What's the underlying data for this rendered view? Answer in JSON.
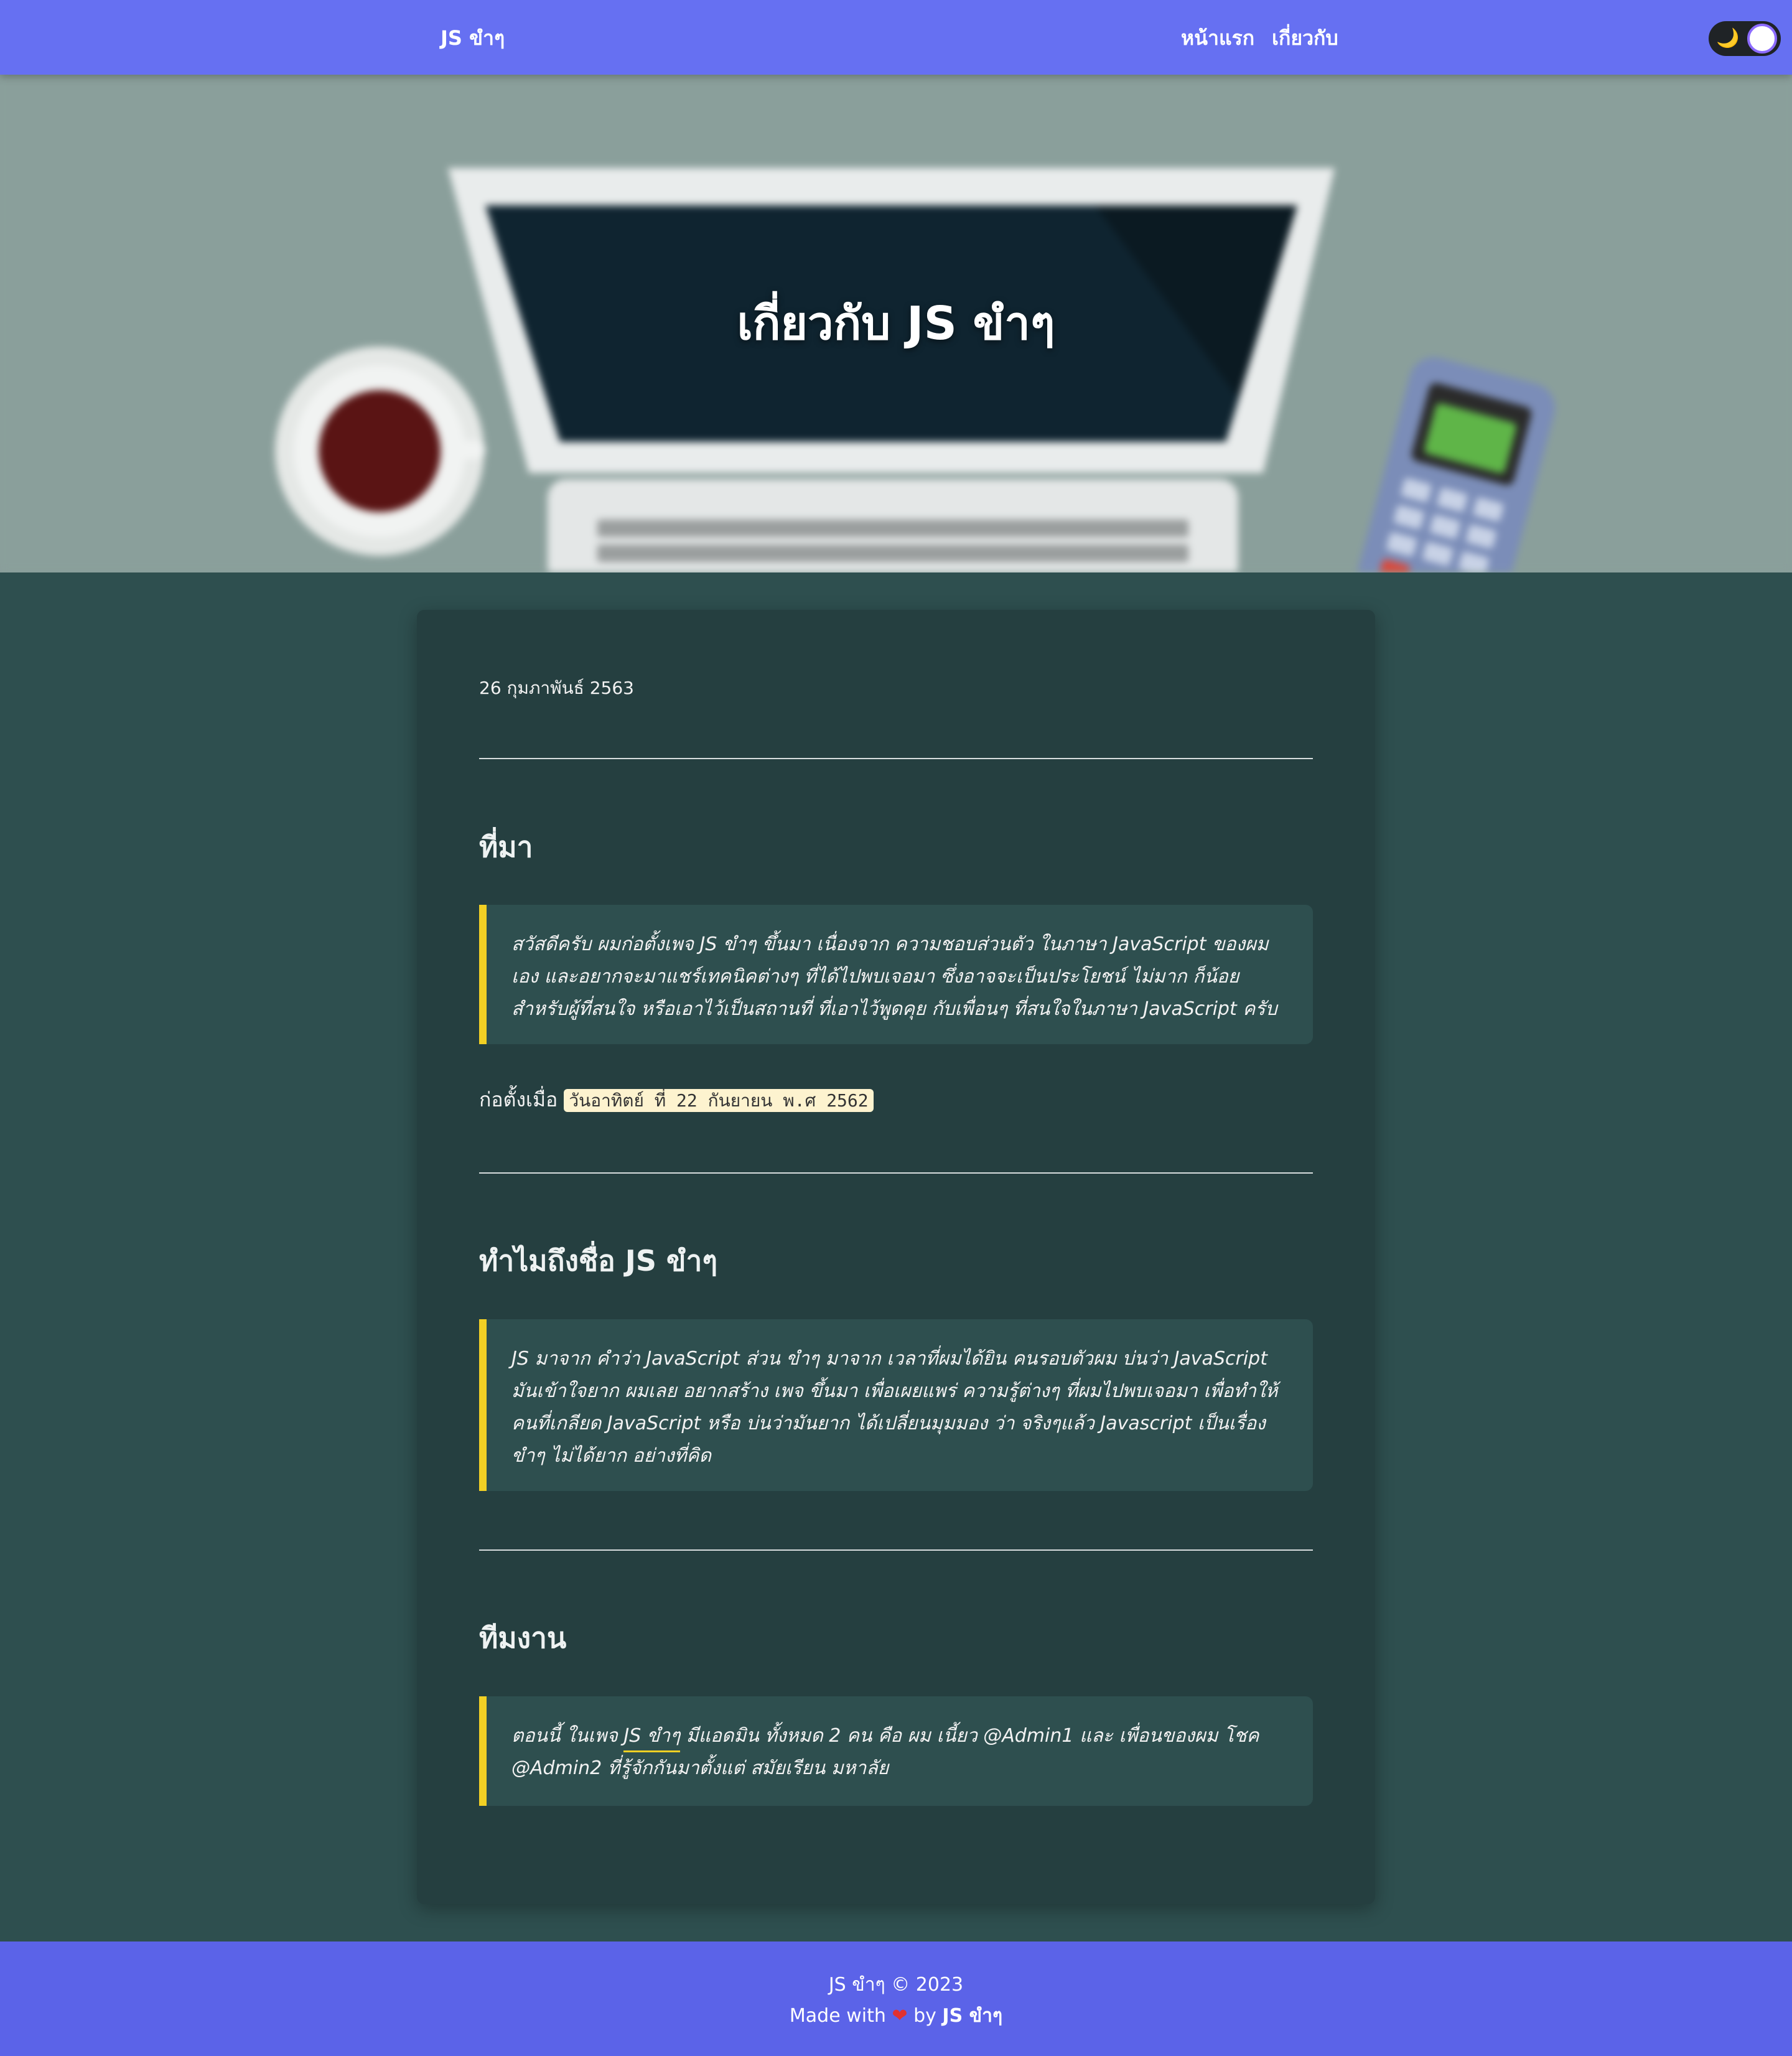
{
  "navbar": {
    "brand": "JS ขำๆ",
    "links": [
      {
        "label": "หน้าแรก"
      },
      {
        "label": "เกี่ยวกับ"
      }
    ],
    "theme_toggle": {
      "icon": "moon-icon",
      "glyph": "🌙"
    }
  },
  "hero": {
    "title": "เกี่ยวกับ JS ขำๆ"
  },
  "article": {
    "date": "26 กุมภาพันธ์ 2563",
    "sections": [
      {
        "heading": "ที่มา",
        "quote": "สวัสดีครับ ผมก่อตั้งเพจ JS ขำๆ ขึ้นมา เนื่องจาก ความชอบส่วนตัว ในภาษา JavaScript ของผมเอง และอยากจะมาแชร์เทคนิคต่างๆ ที่ได้ไปพบเจอมา ซึ่งอาจจะเป็นประโยชน์ ไม่มาก ก็น้อย สำหรับผู้ที่สนใจ หรือเอาไว้เป็นสถานที่ ที่เอาไว้พูดคุย กับเพื่อนๆ ที่สนใจในภาษา JavaScript ครับ"
      },
      {
        "heading": "ทำไมถึงชื่อ JS ขำๆ",
        "quote": "JS มาจาก คำว่า JavaScript ส่วน ขำๆ มาจาก เวลาที่ผมได้ยิน คนรอบตัวผม บ่นว่า JavaScript มันเข้าใจยาก ผมเลย อยากสร้าง เพจ ขึ้นมา เพื่อเผยแพร่ ความรู้ต่างๆ ที่ผมไปพบเจอมา เพื่อทำให้คนที่เกลียด JavaScript หรือ บ่นว่ามันยาก ได้เปลี่ยนมุมมอง ว่า จริงๆแล้ว Javascript เป็นเรื่องขำๆ ไม่ได้ยาก อย่างที่คิด"
      },
      {
        "heading": "ทีมงาน",
        "quote_prefix": "ตอนนี้ ในเพจ ",
        "quote_link": "JS ขำๆ",
        "quote_suffix": " มีแอดมิน ทั้งหมด 2 คน คือ ผม เนี้ยว @Admin1 และ เพื่อนของผม โชค @Admin2 ที่รู้จักกันมาตั้งแต่ สมัยเรียน มหาลัย"
      }
    ],
    "founded_label": "ก่อตั้งเมื่อ",
    "founded_date": "วันอาทิตย์ ที่ 22 กันยายน พ.ศ 2562"
  },
  "footer": {
    "line1": "JS ขำๆ © 2023",
    "made_with": "Made with",
    "heart": "❤",
    "by": "by",
    "brand": "JS ขำๆ"
  },
  "colors": {
    "navbar": "#6670f2",
    "footer": "#5b63e8",
    "page_bg": "#2e4f4f",
    "card_bg": "#253f40",
    "quote_accent": "#f2d024"
  }
}
